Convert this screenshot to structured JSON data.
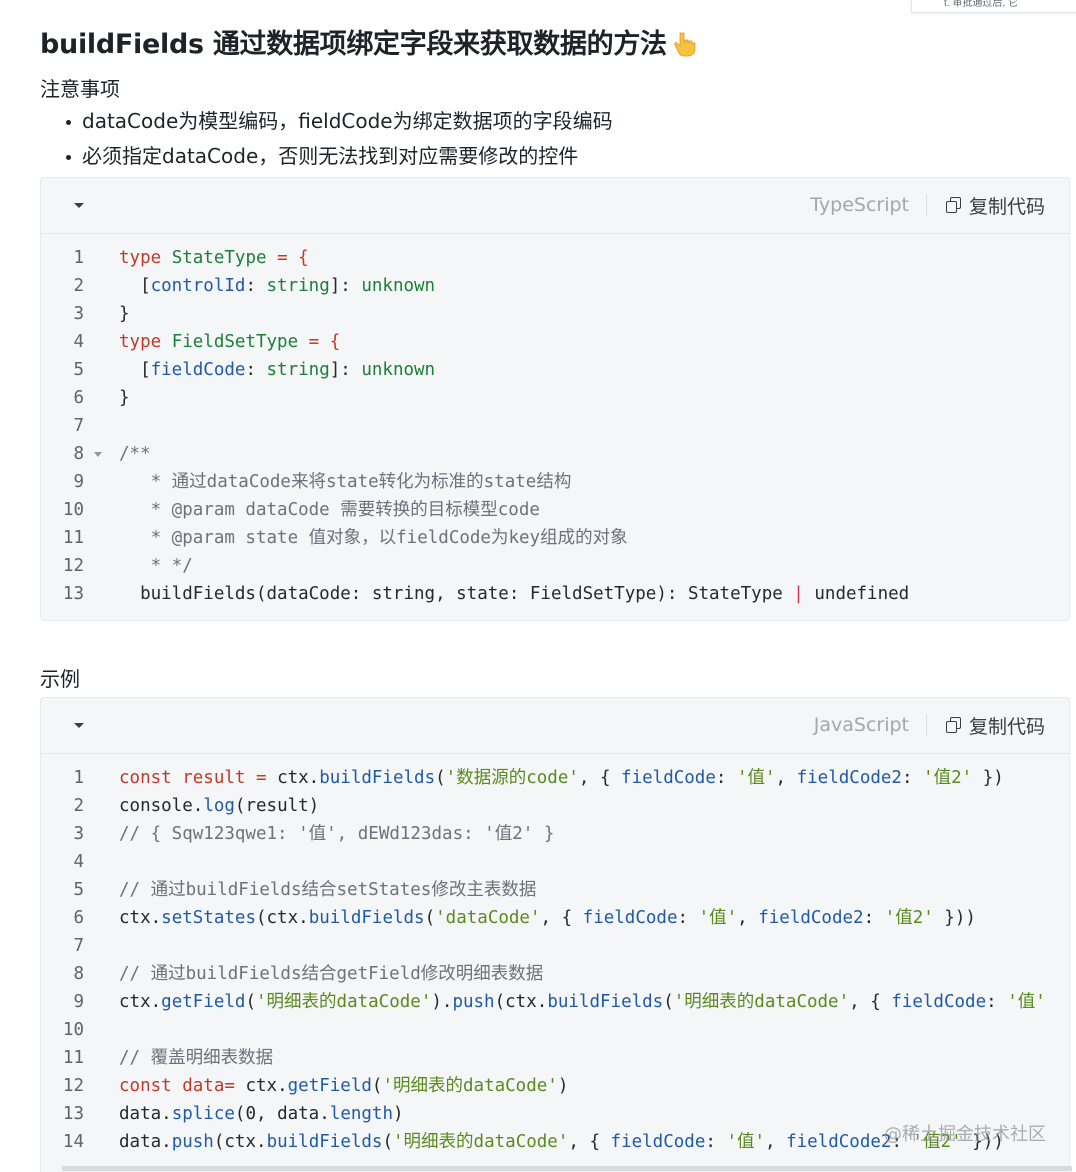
{
  "corner_note": "t. 审批通过后, 它",
  "title": "buildFields 通过数据项绑定字段来获取数据的方法",
  "title_emoji": "pointing-down-hand",
  "notes": {
    "heading": "注意事项",
    "items": [
      "dataCode为模型编码，fieldCode为绑定数据项的字段编码",
      "必须指定dataCode，否则无法找到对应需要修改的控件"
    ]
  },
  "ts_block": {
    "language": "TypeScript",
    "copy_label": "复制代码",
    "line_numbers": [
      "1",
      "2",
      "3",
      "4",
      "5",
      "6",
      "7",
      "8",
      "9",
      "10",
      "11",
      "12",
      "13"
    ]
  },
  "example": {
    "heading": "示例"
  },
  "js_block": {
    "language": "JavaScript",
    "copy_label": "复制代码",
    "line_numbers": [
      "1",
      "2",
      "3",
      "4",
      "5",
      "6",
      "7",
      "8",
      "9",
      "10",
      "11",
      "12",
      "13",
      "14"
    ]
  },
  "watermark": "@稀土掘金技术社区",
  "code_tokens": {
    "ts": {
      "l1": [
        "type",
        "StateType",
        " = {"
      ],
      "l2": [
        "  [",
        "controlId",
        ": ",
        "string",
        "]: ",
        "unknown"
      ],
      "l3": [
        "}"
      ],
      "l4": [
        "type",
        "FieldSetType",
        " = {"
      ],
      "l5": [
        "  [",
        "fieldCode",
        ": ",
        "string",
        "]: ",
        "unknown"
      ],
      "l6": [
        "}"
      ],
      "l7": [
        ""
      ],
      "l8": [
        "/**"
      ],
      "l9": [
        "   * 通过dataCode来将state转化为标准的state结构"
      ],
      "l10": [
        "   * @param dataCode 需要转换的目标模型code"
      ],
      "l11": [
        "   * @param state 值对象，以fieldCode为key组成的对象"
      ],
      "l12": [
        "   * */"
      ],
      "l13": [
        "  buildFields(dataCode: string, state: FieldSetType): StateType ",
        "|",
        " undefined"
      ]
    },
    "js": {
      "l1": [
        "const",
        " ",
        "result",
        " = ",
        "ctx",
        ".",
        "buildFields",
        "(",
        "'数据源的code'",
        ", { ",
        "fieldCode",
        ": ",
        "'值'",
        ", ",
        "fieldCode2",
        ": ",
        "'值2'",
        " })"
      ],
      "l2": [
        "console",
        ".",
        "log",
        "(result)"
      ],
      "l3": [
        "// { Sqw123qwe1: '值', dEWd123das: '值2' }"
      ],
      "l4": [
        ""
      ],
      "l5": [
        "// 通过buildFields结合setStates修改主表数据"
      ],
      "l6": [
        "ctx",
        ".",
        "setStates",
        "(ctx",
        ".",
        "buildFields",
        "(",
        "'dataCode'",
        ", { ",
        "fieldCode",
        ": ",
        "'值'",
        ", ",
        "fieldCode2",
        ": ",
        "'值2'",
        " }))"
      ],
      "l7": [
        ""
      ],
      "l8": [
        "// 通过buildFields结合getField修改明细表数据"
      ],
      "l9": [
        "ctx",
        ".",
        "getField",
        "(",
        "'明细表的dataCode'",
        ")",
        ".",
        "push",
        "(ctx",
        ".",
        "buildFields",
        "(",
        "'明细表的dataCode'",
        ", { ",
        "fieldCode",
        ": ",
        "'值'"
      ],
      "l10": [
        ""
      ],
      "l11": [
        "// 覆盖明细表数据"
      ],
      "l12": [
        "const",
        " ",
        "data",
        "= ",
        "ctx",
        ".",
        "getField",
        "(",
        "'明细表的dataCode'",
        ")"
      ],
      "l13": [
        "data",
        ".",
        "splice",
        "(0, ",
        "data",
        ".",
        "length",
        ")"
      ],
      "l14": [
        "data",
        ".",
        "push",
        "(ctx",
        ".",
        "buildFields",
        "(",
        "'明细表的dataCode'",
        ", { ",
        "fieldCode",
        ": ",
        "'值'",
        ", ",
        "fieldCode2",
        ": ",
        "'值2'",
        " }))"
      ]
    }
  }
}
